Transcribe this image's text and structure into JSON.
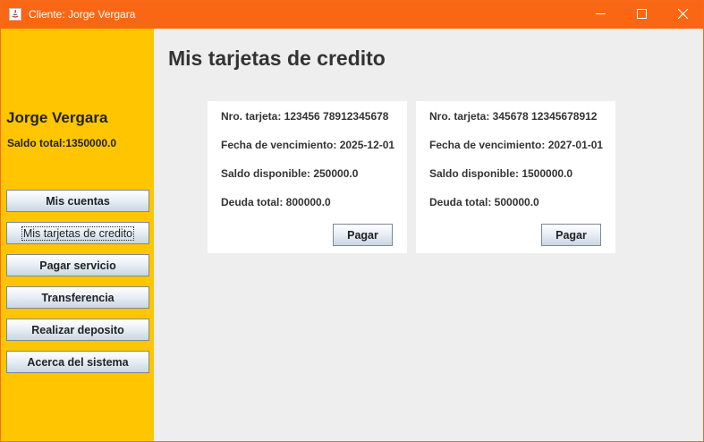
{
  "window": {
    "title": "Cliente: Jorge Vergara",
    "controls": {
      "minimize_icon": "minimize-icon",
      "maximize_icon": "maximize-icon",
      "close_icon": "close-icon"
    }
  },
  "colors": {
    "titlebar": "#f96715",
    "sidebar": "#ffc600",
    "content_bg": "#eeeeee",
    "card_bg": "#ffffff"
  },
  "sidebar": {
    "user_name": "Jorge Vergara",
    "balance": "Saldo total:1350000.0",
    "items": [
      {
        "label": "Mis cuentas"
      },
      {
        "label": "Mis tarjetas de credito",
        "selected": true
      },
      {
        "label": "Pagar servicio"
      },
      {
        "label": "Transferencia"
      },
      {
        "label": "Realizar deposito"
      },
      {
        "label": "Acerca del sistema"
      }
    ]
  },
  "main": {
    "title": "Mis tarjetas de credito",
    "cards": [
      {
        "number": "Nro. tarjeta: 123456 78912345678",
        "expiry": "Fecha de vencimiento: 2025-12-01",
        "available": "Saldo disponible: 250000.0",
        "debt": "Deuda total: 800000.0",
        "pay_label": "Pagar"
      },
      {
        "number": "Nro. tarjeta: 345678 12345678912",
        "expiry": "Fecha de vencimiento: 2027-01-01",
        "available": "Saldo disponible: 1500000.0",
        "debt": "Deuda total: 500000.0",
        "pay_label": "Pagar"
      }
    ]
  }
}
